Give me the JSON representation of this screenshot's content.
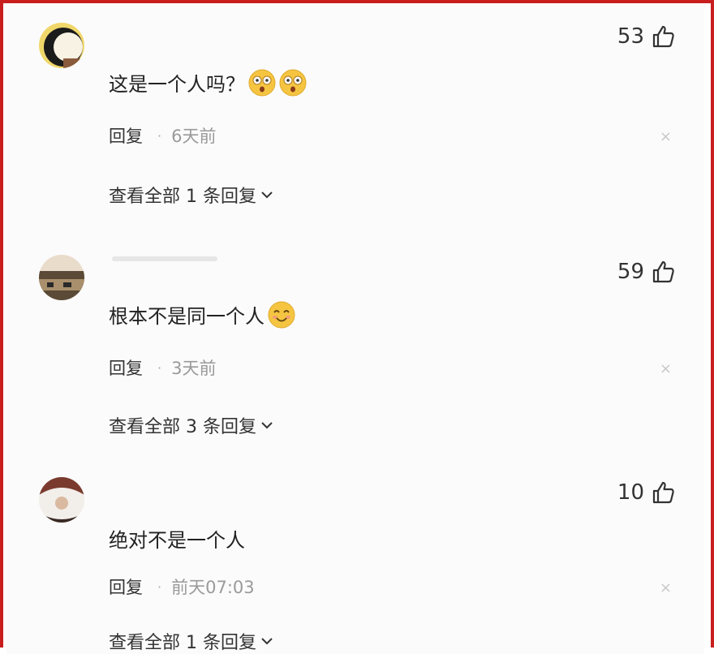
{
  "comments": [
    {
      "likes": "53",
      "text": "这是一个人吗？",
      "emoji": [
        "shocked-face-emoji",
        "shocked-face-emoji"
      ],
      "reply_label": "回复",
      "time": "6天前",
      "view_replies": "查看全部 1 条回复"
    },
    {
      "likes": "59",
      "text": "根本不是同一个人",
      "emoji": [
        "smiling-face-emoji"
      ],
      "reply_label": "回复",
      "time": "3天前",
      "view_replies": "查看全部 3 条回复"
    },
    {
      "likes": "10",
      "text": "绝对不是一个人",
      "emoji": [],
      "reply_label": "回复",
      "time": "前天07:03",
      "view_replies": "查看全部 1 条回复"
    }
  ],
  "separator_dot": "·",
  "close_glyph": "×",
  "colors": {
    "border": "#c81e1e",
    "emoji_yellow": "#f5c542",
    "meta_gray": "#9a9a9a"
  }
}
